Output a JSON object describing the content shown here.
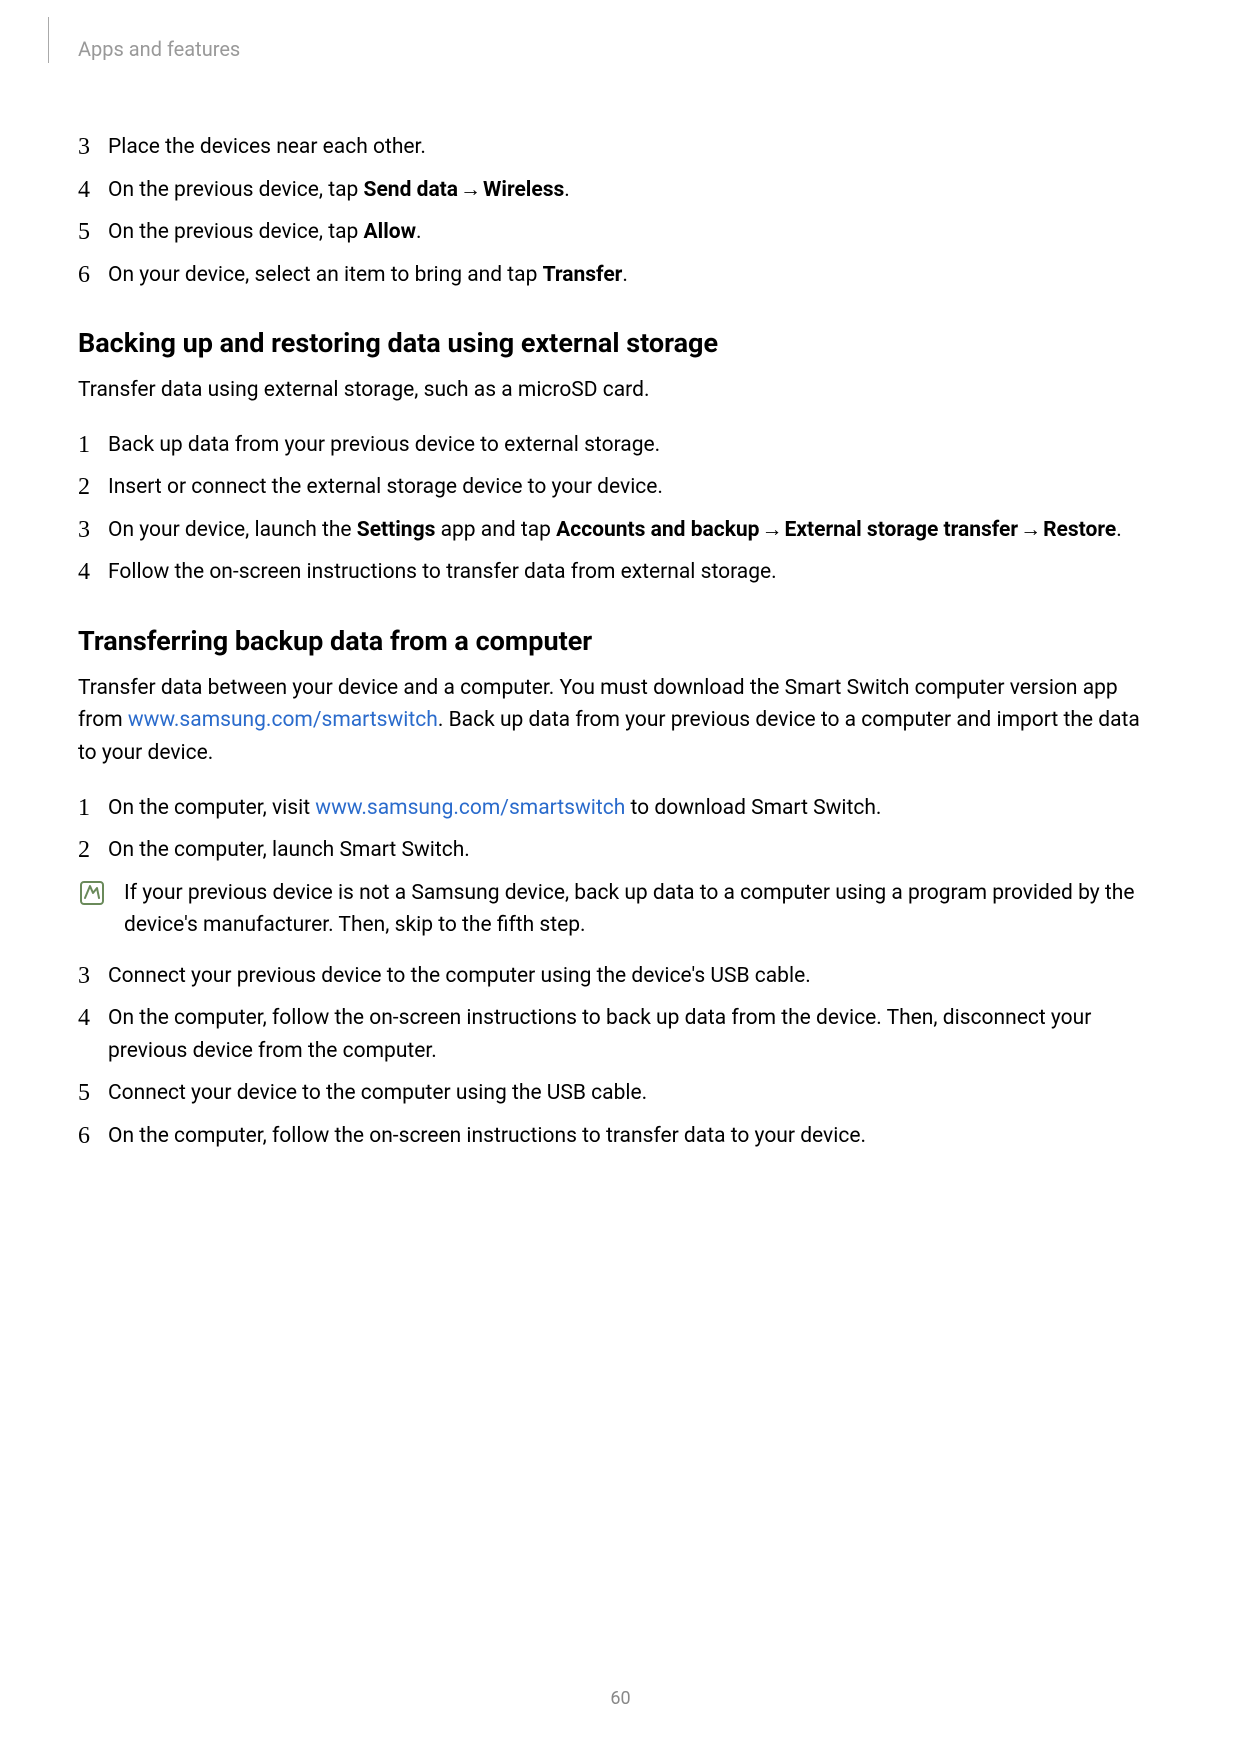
{
  "header": {
    "breadcrumb": "Apps and features"
  },
  "steps1": {
    "start": 3,
    "items": [
      {
        "pre": "Place the devices near each other."
      },
      {
        "pre": "On the previous device, tap ",
        "b1": "Send data",
        "arrow": " → ",
        "b2": "Wireless",
        "post": "."
      },
      {
        "pre": "On the previous device, tap ",
        "b1": "Allow",
        "post": "."
      },
      {
        "pre": "On your device, select an item to bring and tap ",
        "b1": "Transfer",
        "post": "."
      }
    ]
  },
  "section2": {
    "heading": "Backing up and restoring data using external storage",
    "intro": "Transfer data using external storage, such as a microSD card.",
    "steps": [
      {
        "text": "Back up data from your previous device to external storage."
      },
      {
        "text": "Insert or connect the external storage device to your device."
      },
      {
        "pre": "On your device, launch the ",
        "b1": "Settings",
        "mid1": " app and tap ",
        "b2": "Accounts and backup",
        "arrow1": " → ",
        "b3": "External storage transfer",
        "arrow2": " → ",
        "b4": "Restore",
        "post": "."
      },
      {
        "text": "Follow the on-screen instructions to transfer data from external storage."
      }
    ]
  },
  "section3": {
    "heading": "Transferring backup data from a computer",
    "intro_pre": "Transfer data between your device and a computer. You must download the Smart Switch computer version app from ",
    "intro_link": "www.samsung.com/smartswitch",
    "intro_post": ". Back up data from your previous device to a computer and import the data to your device.",
    "steps_a": [
      {
        "pre": "On the computer, visit ",
        "link": "www.samsung.com/smartswitch",
        "post": " to download Smart Switch."
      },
      {
        "text": "On the computer, launch Smart Switch."
      }
    ],
    "note": "If your previous device is not a Samsung device, back up data to a computer using a program provided by the device's manufacturer. Then, skip to the fifth step.",
    "steps_b": [
      {
        "text": "Connect your previous device to the computer using the device's USB cable."
      },
      {
        "text": "On the computer, follow the on-screen instructions to back up data from the device. Then, disconnect your previous device from the computer."
      },
      {
        "text": "Connect your device to the computer using the USB cable."
      },
      {
        "text": "On the computer, follow the on-screen instructions to transfer data to your device."
      }
    ]
  },
  "page_number": "60"
}
